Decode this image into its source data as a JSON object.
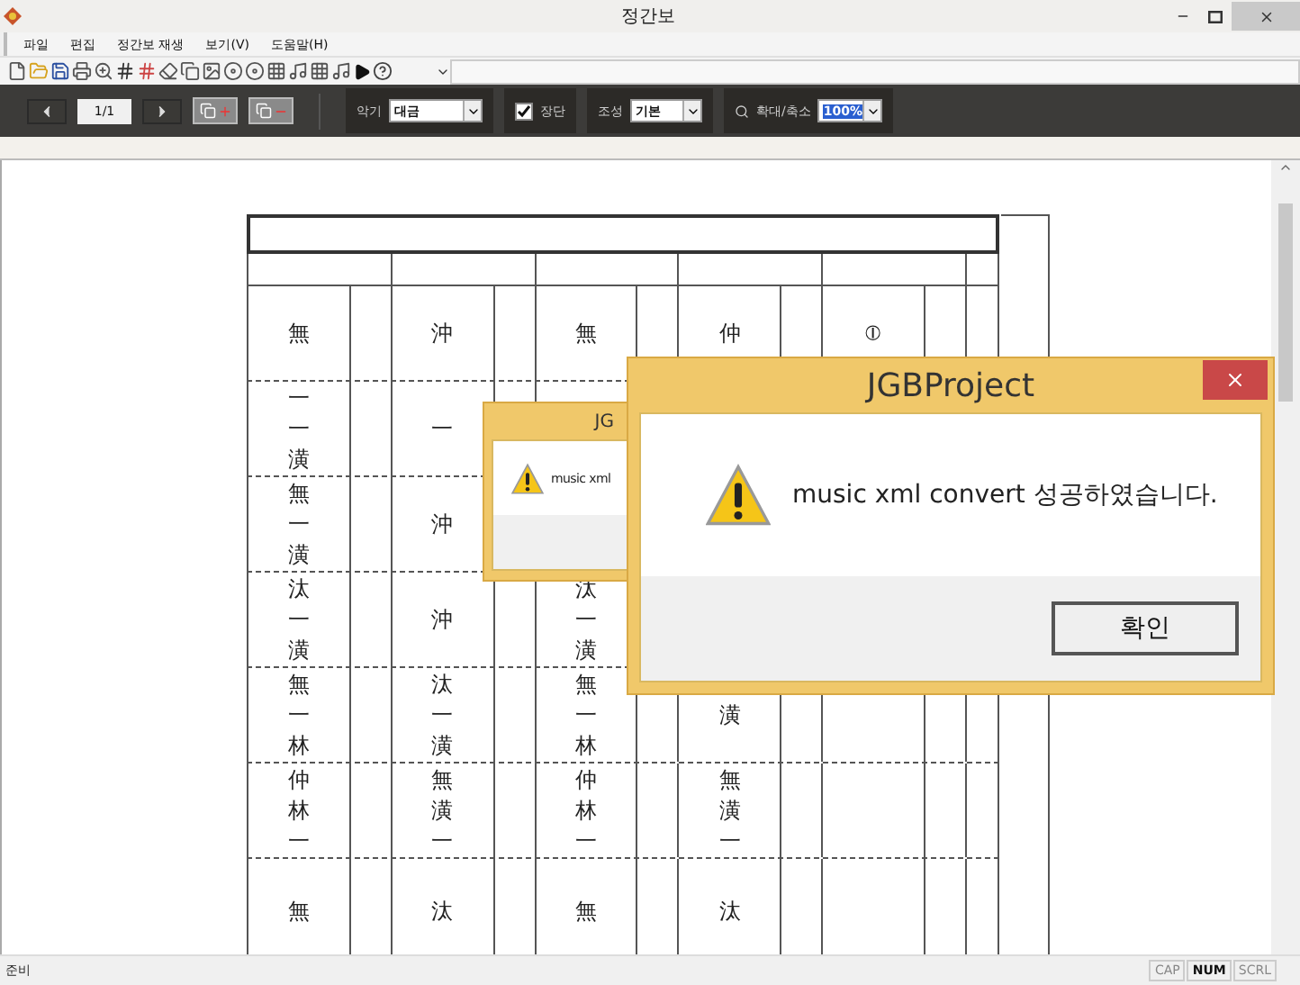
{
  "window": {
    "title": "정간보"
  },
  "menu": [
    "파일",
    "편집",
    "정간보 재생",
    "보기(V)",
    "도움말(H)"
  ],
  "page_nav": {
    "page": "1/1"
  },
  "instrument": {
    "label": "악기",
    "value": "대금"
  },
  "jangdan": {
    "label": "장단",
    "checked": true
  },
  "key": {
    "label": "조성",
    "value": "기본"
  },
  "zoom": {
    "label": "확대/축소",
    "value": "100%"
  },
  "score": {
    "rows": [
      {
        "cells": [
          "無",
          "沖",
          "無",
          "仲",
          "⦶"
        ]
      },
      {
        "cells": [
          "一一潢",
          "一"
        ]
      },
      {
        "cells": [
          "無一潢",
          "沖"
        ]
      },
      {
        "cells": [
          "汰一潢",
          "沖",
          "汰一潢"
        ]
      },
      {
        "cells": [
          "無一林",
          "汰一潢",
          "無一林",
          "潢"
        ]
      },
      {
        "cells": [
          "仲林一",
          "無潢一",
          "仲林一",
          "無潢一"
        ]
      },
      {
        "cells": [
          "無",
          "汰",
          "無",
          "汰"
        ]
      }
    ]
  },
  "dialogs": [
    {
      "kind": "behind",
      "title": "JG",
      "message": "music xml"
    },
    {
      "kind": "front",
      "title": "JGBProject",
      "message": "music xml convert 성공하였습니다.",
      "button": "확인"
    }
  ],
  "status_bar": {
    "text": "준비",
    "indicators": [
      {
        "label": "CAP",
        "on": false
      },
      {
        "label": "NUM",
        "on": true
      },
      {
        "label": "SCRL",
        "on": false
      }
    ]
  }
}
